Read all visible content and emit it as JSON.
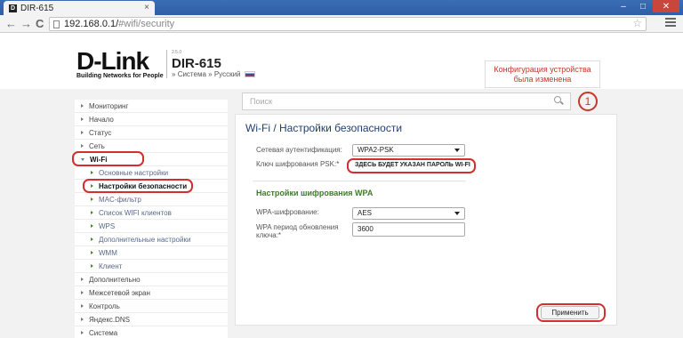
{
  "browser": {
    "tab_title": "DIR-615",
    "tab_close": "×",
    "favicon": "D",
    "address_host": "192.168.0.1/",
    "address_path": "#wifi/security",
    "win_minimize": "–",
    "win_maximize": "□",
    "win_close": "✕",
    "back": "←",
    "forward": "→",
    "reload": "C",
    "star": "☆"
  },
  "header": {
    "logo": "D-Link",
    "tagline": "Building Networks for People",
    "fw_version": "2.5.0",
    "model": "DIR-615",
    "system_link": "Система",
    "language_link": "Русский",
    "link_marker": "»",
    "notice": "Конфигурация устройства была изменена"
  },
  "search": {
    "placeholder": "Поиск",
    "notification_count": "1"
  },
  "sidebar": {
    "items": [
      {
        "label": "Мониторинг"
      },
      {
        "label": "Начало"
      },
      {
        "label": "Статус"
      },
      {
        "label": "Сеть"
      },
      {
        "label": "Wi-Fi"
      },
      {
        "label": "Основные настройки"
      },
      {
        "label": "Настройки безопасности"
      },
      {
        "label": "MAC-фильтр"
      },
      {
        "label": "Список WIFI клиентов"
      },
      {
        "label": "WPS"
      },
      {
        "label": "Дополнительные настройки"
      },
      {
        "label": "WMM"
      },
      {
        "label": "Клиент"
      },
      {
        "label": "Дополнительно"
      },
      {
        "label": "Межсетевой экран"
      },
      {
        "label": "Контроль"
      },
      {
        "label": "Яндекс.DNS"
      },
      {
        "label": "Система"
      }
    ]
  },
  "main": {
    "title": "Wi-Fi /  Настройки безопасности",
    "auth_label": "Сетевая аутентификация:",
    "auth_value": "WPA2-PSK",
    "psk_label": "Ключ шифрования PSK:*",
    "psk_value": "ЗДЕСЬ БУДЕТ УКАЗАН ПАРОЛЬ WI-FI",
    "section_title": "Настройки шифрования WPA",
    "wpa_enc_label": "WPA-шифрование:",
    "wpa_enc_value": "AES",
    "wpa_period_label_1": "WPA период обновления",
    "wpa_period_label_2": "ключа:*",
    "wpa_period_value": "3600",
    "apply_label": "Применить"
  },
  "colors": {
    "highlight": "#d32f2f",
    "title": "#1f3f6e",
    "section": "#3e7a2a",
    "notice": "#c0392b"
  }
}
